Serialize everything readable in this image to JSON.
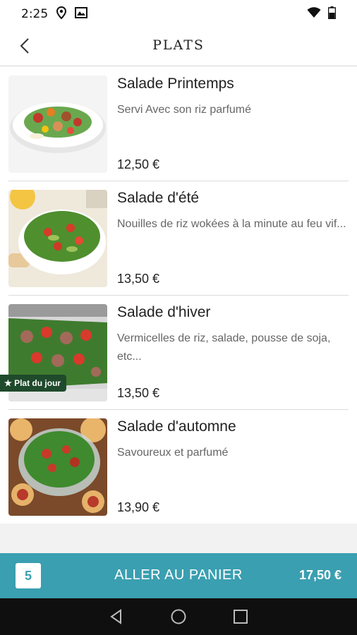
{
  "status_bar": {
    "time": "2:25",
    "icons": [
      "location-pin-icon",
      "gallery-icon",
      "wifi-icon",
      "battery-icon"
    ]
  },
  "app_bar": {
    "title": "PLATS",
    "back_icon": "chevron-left-icon"
  },
  "dishes": [
    {
      "name": "Salade Printemps",
      "description": "Servi Avec son riz parfumé",
      "price": "12,50 €",
      "badge": null
    },
    {
      "name": "Salade d'été",
      "description": "Nouilles de riz wokées à la minute au feu vif...",
      "price": "13,50 €",
      "badge": null
    },
    {
      "name": "Salade d'hiver",
      "description": "Vermicelles de riz, salade, pousse de soja, etc...",
      "price": "13,50 €",
      "badge": "★ Plat du jour"
    },
    {
      "name": "Salade d'automne",
      "description": "Savoureux et parfumé",
      "price": "13,90 €",
      "badge": null
    }
  ],
  "cart": {
    "count": "5",
    "label": "ALLER AU PANIER",
    "total": "17,50 €",
    "color": "#3a9fb0"
  },
  "nav_bar": {
    "icons": [
      "back-triangle-icon",
      "home-circle-icon",
      "recents-square-icon"
    ]
  }
}
